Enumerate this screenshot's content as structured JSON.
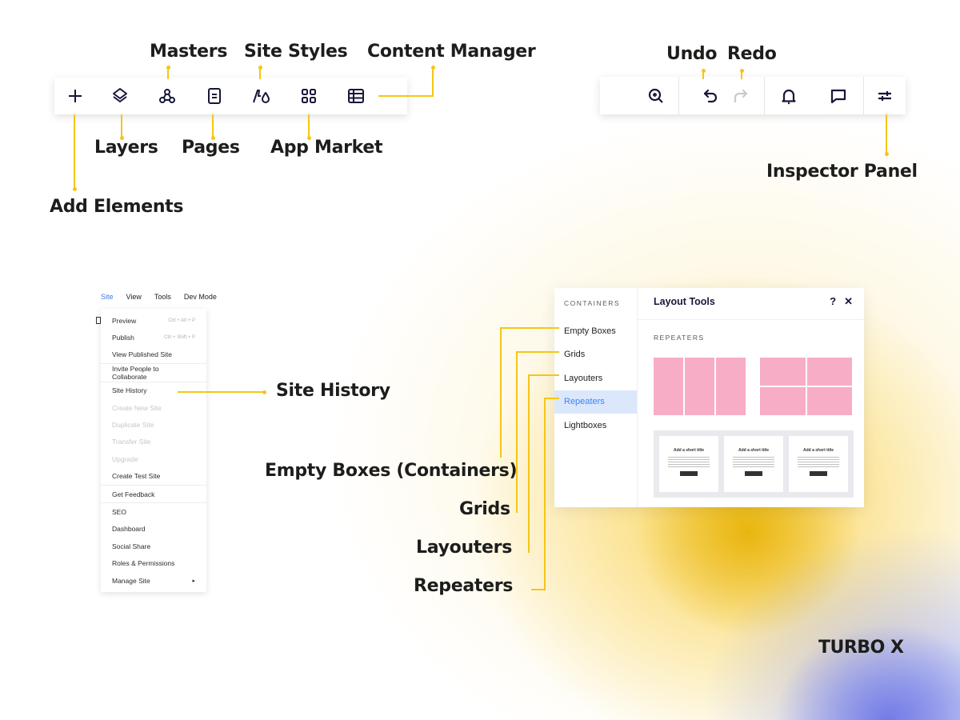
{
  "left_toolbar": {
    "buttons": [
      {
        "icon": "plus-icon",
        "label": "Add Elements"
      },
      {
        "icon": "layers-icon",
        "label": "Layers"
      },
      {
        "icon": "masters-icon",
        "label": "Masters"
      },
      {
        "icon": "pages-icon",
        "label": "Pages"
      },
      {
        "icon": "site-styles-icon",
        "label": "Site Styles"
      },
      {
        "icon": "app-market-icon",
        "label": "App Market"
      },
      {
        "icon": "content-manager-icon",
        "label": "Content Manager"
      }
    ]
  },
  "right_toolbar": {
    "buttons": [
      {
        "icon": "zoom-in-icon"
      },
      {
        "icon": "undo-icon",
        "label": "Undo"
      },
      {
        "icon": "redo-icon",
        "label": "Redo",
        "disabled": true
      },
      {
        "icon": "bell-icon"
      },
      {
        "icon": "comment-icon"
      },
      {
        "icon": "sliders-icon",
        "label": "Inspector Panel"
      }
    ]
  },
  "callouts": {
    "masters": "Masters",
    "site_styles": "Site Styles",
    "content_manager": "Content Manager",
    "layers": "Layers",
    "pages": "Pages",
    "app_market": "App Market",
    "add_elements": "Add Elements",
    "undo": "Undo",
    "redo": "Redo",
    "inspector_panel": "Inspector Panel",
    "site_history": "Site History",
    "empty_boxes": "Empty Boxes (Containers)",
    "grids": "Grids",
    "layouters": "Layouters",
    "repeaters": "Repeaters"
  },
  "site_menu": {
    "menubar": [
      "Site",
      "View",
      "Tools",
      "Dev Mode"
    ],
    "active_menu": "Site",
    "items": [
      {
        "label": "Preview",
        "shortcut": "Ctrl + Alt + P"
      },
      {
        "label": "Publish",
        "shortcut": "Ctrl + Shift + P"
      },
      {
        "label": "View Published Site"
      },
      {
        "label": "Invite People to Collaborate"
      },
      {
        "label": "Site History"
      },
      {
        "label": "Create New Site",
        "disabled": true
      },
      {
        "label": "Duplicate Site",
        "disabled": true
      },
      {
        "label": "Transfer Site",
        "disabled": true
      },
      {
        "label": "Upgrade",
        "disabled": true
      },
      {
        "label": "Create Test Site"
      },
      {
        "label": "Get Feedback"
      },
      {
        "label": "SEO"
      },
      {
        "label": "Dashboard"
      },
      {
        "label": "Social Share"
      },
      {
        "label": "Roles & Permissions"
      },
      {
        "label": "Manage Site",
        "submenu": "▸"
      }
    ]
  },
  "layout_tools": {
    "title": "Layout Tools",
    "help": "?",
    "close": "✕",
    "sidebar_title": "CONTAINERS",
    "sidebar_items": [
      "Empty Boxes",
      "Grids",
      "Layouters",
      "Repeaters",
      "Lightboxes"
    ],
    "active_item": "Repeaters",
    "section_title": "REPEATERS",
    "card_title": "Add a short title"
  },
  "brand": {
    "logo": "TURBO X"
  },
  "colors": {
    "accent_line": "#f5c518",
    "active_blue": "#3b82f6",
    "pink_tile": "#f7adc5"
  }
}
